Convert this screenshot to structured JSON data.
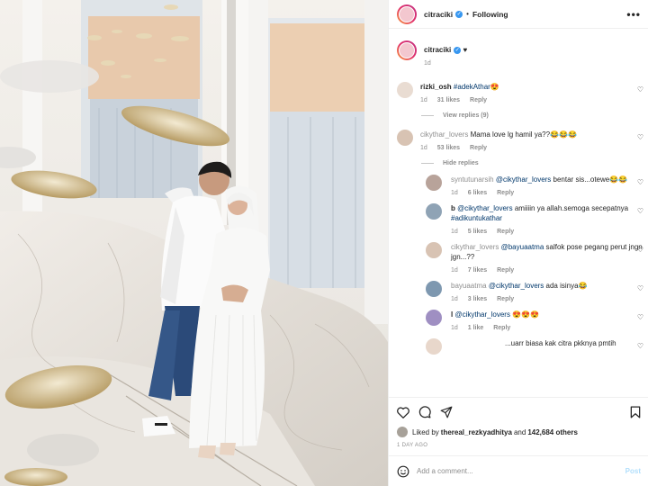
{
  "header": {
    "username": "citraciki",
    "separator": "•",
    "follow_status": "Following",
    "more": "•••"
  },
  "caption": {
    "username": "citraciki",
    "text": "♥",
    "time": "1d"
  },
  "comments": [
    {
      "username": "rizki_osh",
      "text": "#adekAthar😍",
      "time": "1d",
      "likes": "31 likes",
      "reply": "Reply",
      "replies_toggle": "View replies (9)"
    },
    {
      "username": "cikythar_lovers",
      "text": "Mama love lg hamil ya??😂😂😂",
      "time": "1d",
      "likes": "53 likes",
      "reply": "Reply",
      "replies_toggle": "Hide replies"
    }
  ],
  "replies": [
    {
      "username": "syntutunarsih",
      "mention": "@cikythar_lovers",
      "text": " bentar sis...otewe😂😂",
      "time": "1d",
      "likes": "6 likes",
      "reply": "Reply"
    },
    {
      "username": "b",
      "mention": "@cikythar_lovers",
      "text": " amiiiin ya allah.semoga secepatnya ",
      "tag": "#adikuntukathar",
      "time": "1d",
      "likes": "5 likes",
      "reply": "Reply"
    },
    {
      "username": "cikythar_lovers",
      "mention": "@bayuaatma",
      "text": " salfok pose pegang perut jngn jgn...??",
      "time": "1d",
      "likes": "7 likes",
      "reply": "Reply"
    },
    {
      "username": "bayuaatma",
      "mention": "@cikythar_lovers",
      "text": " ada isinya😂",
      "time": "1d",
      "likes": "3 likes",
      "reply": "Reply"
    },
    {
      "username": "l",
      "mention": "@cikythar_lovers",
      "text": " 😍😍😍",
      "time": "1d",
      "likes": "1 like",
      "reply": "Reply"
    },
    {
      "username": "",
      "mention": "",
      "text": "...uarr biasa kak citra pkknya pmtih",
      "time": "",
      "likes": "",
      "reply": ""
    }
  ],
  "actions": {
    "liked_by_prefix": "Liked by ",
    "liked_by_user": "thereal_rezkyadhitya",
    "liked_by_suffix": " and ",
    "others": "142,684 others",
    "time_ago": "1 DAY AGO"
  },
  "add_comment": {
    "placeholder": "Add a comment...",
    "post_label": "Post"
  },
  "colors": {
    "link_blue": "#00376b",
    "verified_blue": "#3897f0",
    "post_disabled": "#b2dffc",
    "secondary_text": "#8e8e8e"
  }
}
